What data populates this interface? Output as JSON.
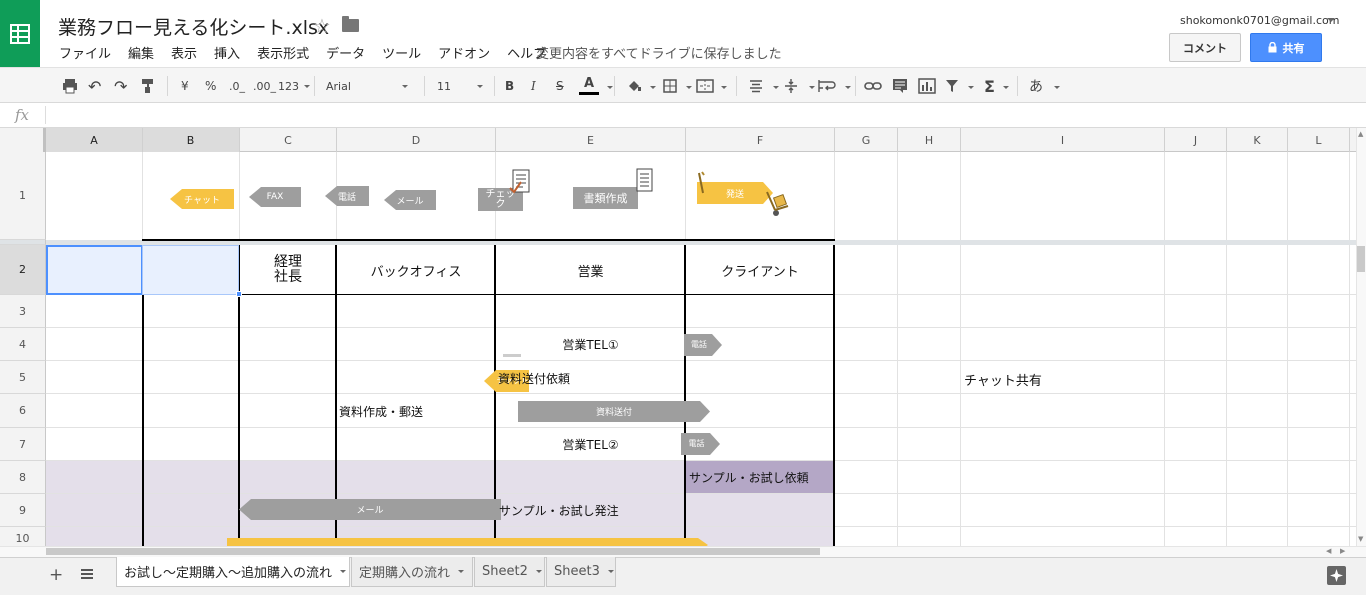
{
  "header": {
    "title": "業務フロー見える化シート.xlsx",
    "menu": [
      "ファイル",
      "編集",
      "表示",
      "挿入",
      "表示形式",
      "データ",
      "ツール",
      "アドオン",
      "ヘルプ"
    ],
    "save_status": "変更内容をすべてドライブに保存しました",
    "account": "shokomonk0701@gmail.com",
    "comment_label": "コメント",
    "share_label": "共有"
  },
  "toolbar": {
    "currency": "¥",
    "percent": "%",
    "dec_less": ".0_",
    "dec_more": ".00_",
    "format_more": "123",
    "font": "Arial",
    "font_size": "11",
    "bold": "B",
    "italic": "I",
    "strike": "S",
    "text_color": "A",
    "input_tools": "あ"
  },
  "formula_bar": {
    "fx": "fx",
    "value": ""
  },
  "columns": [
    "A",
    "B",
    "C",
    "D",
    "E",
    "F",
    "G",
    "H",
    "I",
    "J",
    "K",
    "L"
  ],
  "rows": [
    "1",
    "2",
    "3",
    "4",
    "5",
    "6",
    "7",
    "8",
    "9",
    "10"
  ],
  "legend_shapes": {
    "chat": "チャット",
    "fax": "FAX",
    "phone": "電話",
    "mail": "メール",
    "check": "チェック",
    "document": "書類作成",
    "shipping": "発送"
  },
  "lanes": {
    "c2_line1": "経理",
    "c2_line2": "社長",
    "d2": "バックオフィス",
    "e2": "営業",
    "f2": "クライアント"
  },
  "cells": {
    "e4": "営業TEL①",
    "e5": "資料送付依頼",
    "i5": "チャット共有",
    "d6": "資料作成・郵送",
    "e7": "営業TEL②",
    "f8": "サンプル・お試し依頼",
    "e9": "サンプル・お試し発注"
  },
  "flow_shapes": {
    "phone1": "電話",
    "chat5": "チャット",
    "send6": "資料送付",
    "phone7": "電話",
    "mail9": "メール"
  },
  "colors": {
    "accent_green": "#0f9d58",
    "share_blue": "#4d90fe",
    "band_purple": "#e4dfea",
    "cell_purple": "#b4a7c6"
  },
  "sheets": [
    {
      "name": "お試し〜定期購入〜追加購入の流れ",
      "active": true
    },
    {
      "name": "定期購入の流れ",
      "active": false
    },
    {
      "name": "Sheet2",
      "active": false
    },
    {
      "name": "Sheet3",
      "active": false
    }
  ]
}
